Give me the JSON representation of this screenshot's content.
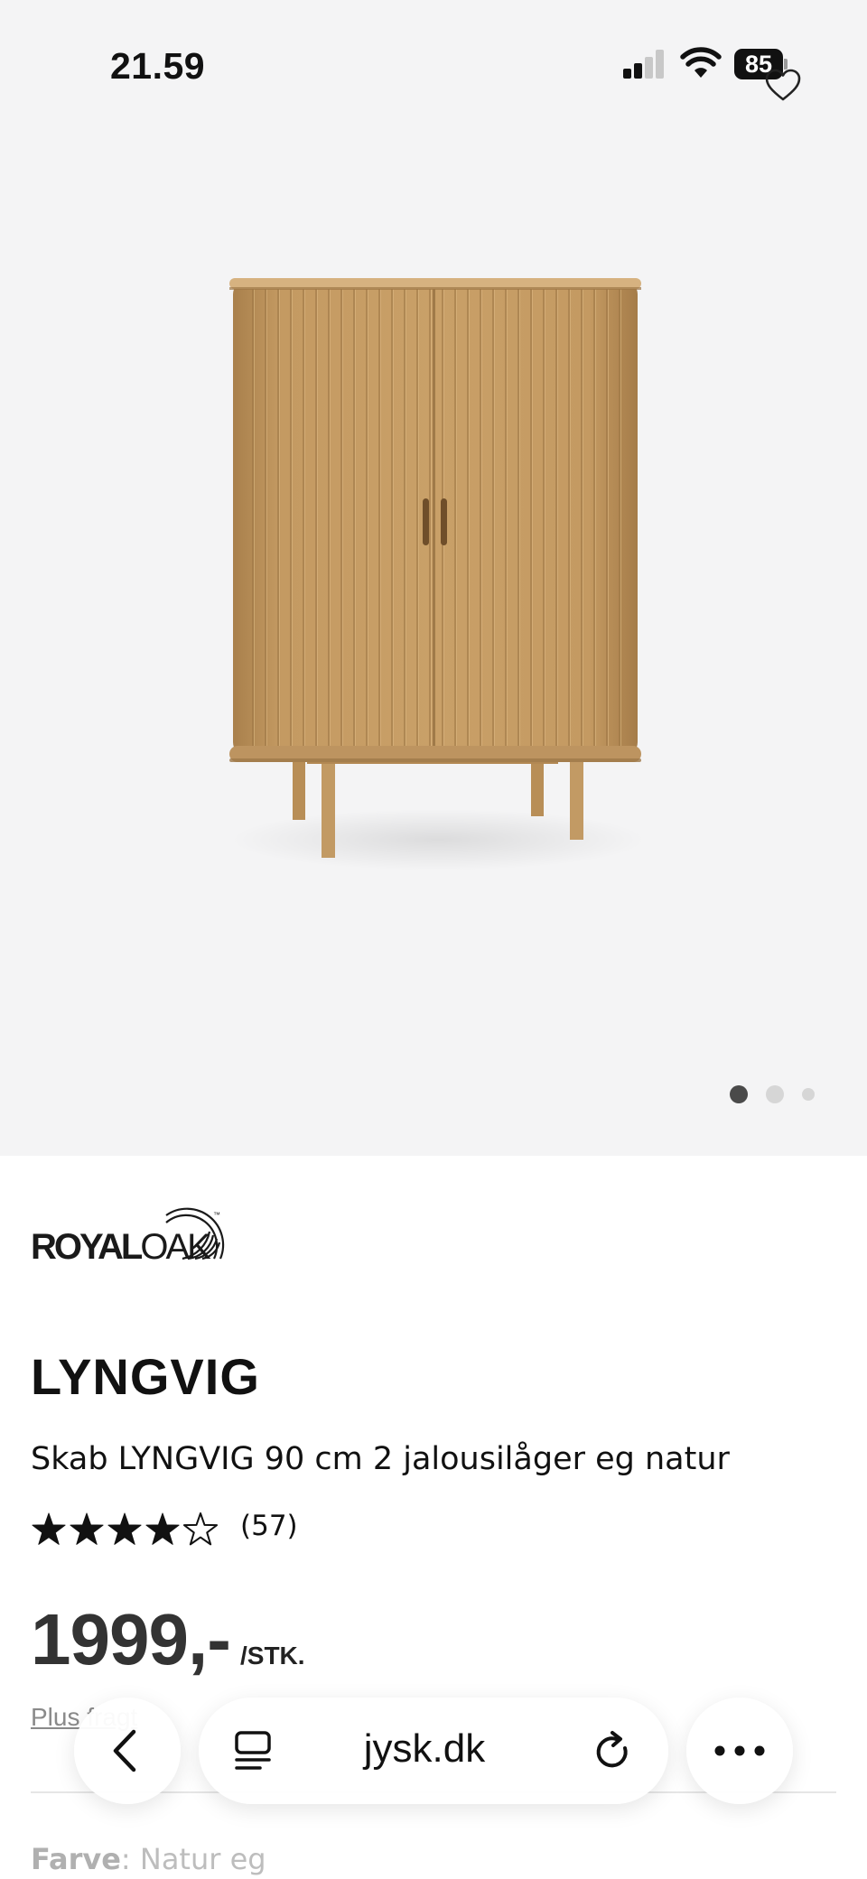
{
  "status_bar": {
    "time": "21.59",
    "battery": "85",
    "icons": [
      "cellular-signal-icon",
      "wifi-icon",
      "battery-icon"
    ]
  },
  "gallery": {
    "image": "wooden-tambour-cabinet",
    "slide_count": 3,
    "active_slide": 1,
    "favorite_icon": "heart-outline-icon"
  },
  "product": {
    "brand": "ROYALOAK",
    "brand_trademark": "™",
    "title": "LYNGVIG",
    "description": "Skab LYNGVIG 90 cm 2 jalousilåger eg natur",
    "rating": 4,
    "rating_max": 5,
    "review_count": "(57)",
    "price": "1999,-",
    "price_unit": "/STK.",
    "shipping_text": "Plus fragt",
    "color_label": "Farve",
    "color_value": ": Natur eg"
  },
  "browser": {
    "url": "jysk.dk",
    "back_icon": "chevron-left-icon",
    "tab_icon": "tabs-list-icon",
    "reload_icon": "reload-icon",
    "more_icon": "more-dots-icon"
  },
  "colors": {
    "gallery_bg": "#f4f4f5",
    "wood": "#c49a62",
    "price_text": "#333333",
    "muted_text": "#8a8a8a"
  }
}
